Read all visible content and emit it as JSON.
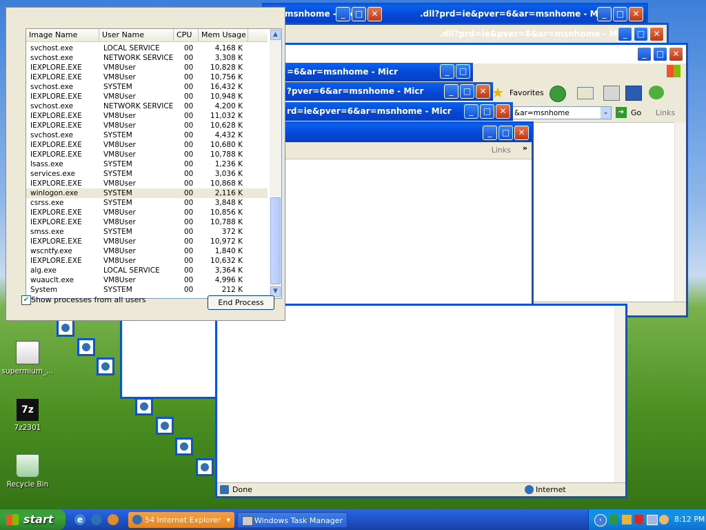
{
  "ie_windows": {
    "title_fragments": [
      "msnhome - Micr",
      ".dll?prd=ie&pver=6&ar=msnhome - Micr",
      ".dll?prd=ie&pver=6&ar=msnhome - Micr",
      ".dll?prd=ie&pver=6&ar=msnhome - Micr",
      "=6&ar=msnhome - Micr",
      "?pver=6&ar=msnhome - Micr",
      "rd=ie&pver=6&ar=msnhome - Micr",
      ".dll?prd=ie&pver=6&ar=msnhome - Micr"
    ],
    "favorites_label": "Favorites",
    "address_value": "&ar=msnhome",
    "go_label": "Go",
    "links_label": "Links",
    "status_zone": "Internet",
    "status_done": "Done"
  },
  "task_manager": {
    "columns": [
      "Image Name",
      "User Name",
      "CPU",
      "Mem Usage"
    ],
    "processes": [
      {
        "image": "svchost.exe",
        "user": "LOCAL SERVICE",
        "cpu": "00",
        "mem": "4,168 K"
      },
      {
        "image": "svchost.exe",
        "user": "NETWORK SERVICE",
        "cpu": "00",
        "mem": "3,308 K"
      },
      {
        "image": "IEXPLORE.EXE",
        "user": "VM8User",
        "cpu": "00",
        "mem": "10,828 K"
      },
      {
        "image": "IEXPLORE.EXE",
        "user": "VM8User",
        "cpu": "00",
        "mem": "10,756 K"
      },
      {
        "image": "svchost.exe",
        "user": "SYSTEM",
        "cpu": "00",
        "mem": "16,432 K"
      },
      {
        "image": "IEXPLORE.EXE",
        "user": "VM8User",
        "cpu": "00",
        "mem": "10,948 K"
      },
      {
        "image": "svchost.exe",
        "user": "NETWORK SERVICE",
        "cpu": "00",
        "mem": "4,200 K"
      },
      {
        "image": "IEXPLORE.EXE",
        "user": "VM8User",
        "cpu": "00",
        "mem": "11,032 K"
      },
      {
        "image": "IEXPLORE.EXE",
        "user": "VM8User",
        "cpu": "00",
        "mem": "10,628 K"
      },
      {
        "image": "svchost.exe",
        "user": "SYSTEM",
        "cpu": "00",
        "mem": "4,432 K"
      },
      {
        "image": "IEXPLORE.EXE",
        "user": "VM8User",
        "cpu": "00",
        "mem": "10,680 K"
      },
      {
        "image": "IEXPLORE.EXE",
        "user": "VM8User",
        "cpu": "00",
        "mem": "10,788 K"
      },
      {
        "image": "lsass.exe",
        "user": "SYSTEM",
        "cpu": "00",
        "mem": "1,236 K"
      },
      {
        "image": "services.exe",
        "user": "SYSTEM",
        "cpu": "00",
        "mem": "3,036 K"
      },
      {
        "image": "IEXPLORE.EXE",
        "user": "VM8User",
        "cpu": "00",
        "mem": "10,868 K"
      },
      {
        "image": "winlogon.exe",
        "user": "SYSTEM",
        "cpu": "00",
        "mem": "2,116 K"
      },
      {
        "image": "csrss.exe",
        "user": "SYSTEM",
        "cpu": "00",
        "mem": "3,848 K"
      },
      {
        "image": "IEXPLORE.EXE",
        "user": "VM8User",
        "cpu": "00",
        "mem": "10,856 K"
      },
      {
        "image": "IEXPLORE.EXE",
        "user": "VM8User",
        "cpu": "00",
        "mem": "10,788 K"
      },
      {
        "image": "smss.exe",
        "user": "SYSTEM",
        "cpu": "00",
        "mem": "372 K"
      },
      {
        "image": "IEXPLORE.EXE",
        "user": "VM8User",
        "cpu": "00",
        "mem": "10,972 K"
      },
      {
        "image": "wscntfy.exe",
        "user": "VM8User",
        "cpu": "00",
        "mem": "1,840 K"
      },
      {
        "image": "IEXPLORE.EXE",
        "user": "VM8User",
        "cpu": "00",
        "mem": "10,632 K"
      },
      {
        "image": "alg.exe",
        "user": "LOCAL SERVICE",
        "cpu": "00",
        "mem": "3,364 K"
      },
      {
        "image": "wuauclt.exe",
        "user": "VM8User",
        "cpu": "00",
        "mem": "4,996 K"
      },
      {
        "image": "System",
        "user": "SYSTEM",
        "cpu": "00",
        "mem": "212 K"
      }
    ],
    "selected_process": "winlogon.exe",
    "show_all_label": "Show processes from all users",
    "show_all_checked": true,
    "end_process_label": "End Process"
  },
  "desktop_icons": [
    {
      "label": "supermium_...",
      "icon": "installer-icon"
    },
    {
      "label": "7z2301",
      "icon": "7zip-icon"
    },
    {
      "label": "Recycle Bin",
      "icon": "recycle-bin-icon"
    }
  ],
  "taskbar": {
    "start_label": "start",
    "quick_launch": [
      "ie-icon",
      "firefox-icon",
      "media-icon"
    ],
    "tasks": [
      {
        "label": "54 Internet Explorer",
        "icon": "ie-icon"
      },
      {
        "label": "Windows Task Manager",
        "icon": "task-manager-icon"
      }
    ],
    "clock": "8:12 PM"
  },
  "colors": {
    "xp_blue": "#0a52d6",
    "start_green": "#3aa33a",
    "orange_task": "#e8841c"
  }
}
